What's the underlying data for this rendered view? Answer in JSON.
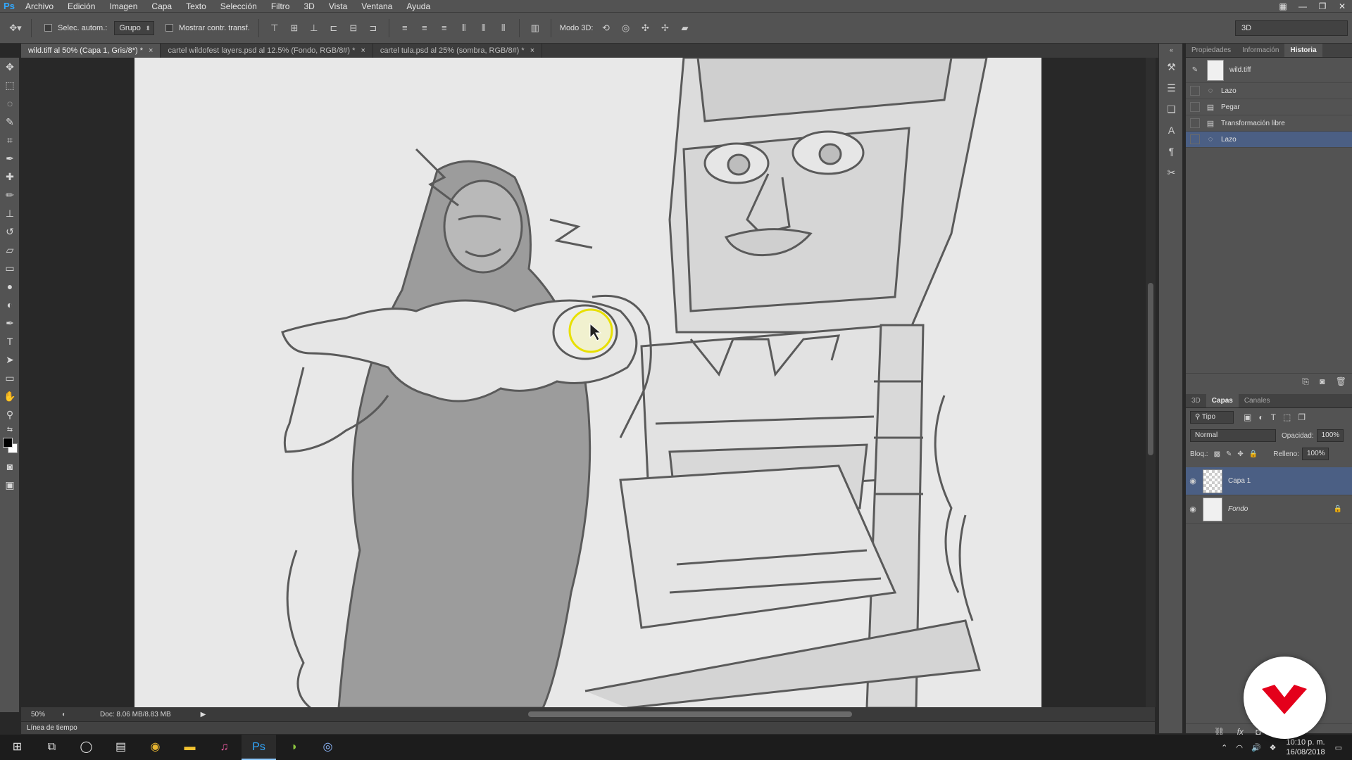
{
  "app": {
    "logo": "Ps"
  },
  "menu": [
    "Archivo",
    "Edición",
    "Imagen",
    "Capa",
    "Texto",
    "Selección",
    "Filtro",
    "3D",
    "Vista",
    "Ventana",
    "Ayuda"
  ],
  "options": {
    "auto_select_label": "Selec. autom.:",
    "auto_select_value": "Grupo",
    "transform_label": "Mostrar contr. transf.",
    "mode3d_label": "Modo 3D:",
    "workspace": "3D"
  },
  "tabs": [
    {
      "label": "wild.tiff al 50% (Capa 1, Gris/8*) *",
      "close": "×"
    },
    {
      "label": "cartel wildofest layers.psd al 12.5% (Fondo, RGB/8#) *",
      "close": "×"
    },
    {
      "label": "cartel tula.psd al 25% (sombra, RGB/8#) *",
      "close": "×"
    }
  ],
  "status": {
    "zoom": "50%",
    "doc": "Doc: 8.06 MB/8.83 MB"
  },
  "timeline": {
    "label": "Línea de tiempo"
  },
  "history_panel": {
    "tabs": [
      "Propiedades",
      "Información",
      "Historia"
    ],
    "snapshot": "wild.tiff",
    "items": [
      {
        "label": "Lazo"
      },
      {
        "label": "Pegar"
      },
      {
        "label": "Transformación libre"
      },
      {
        "label": "Lazo"
      }
    ]
  },
  "layers_panel": {
    "tabs": [
      "3D",
      "Capas",
      "Canales"
    ],
    "filter": "Tipo",
    "blend_mode": "Normal",
    "opacity_label": "Opacidad:",
    "opacity_value": "100%",
    "lock_label": "Bloq.:",
    "fill_label": "Relleno:",
    "fill_value": "100%",
    "layers": [
      {
        "name": "Capa 1"
      },
      {
        "name": "Fondo"
      }
    ]
  },
  "taskbar": {
    "time": "10:10 p. m.",
    "date": "16/08/2018"
  },
  "colors": {
    "accent": "#31a8ff",
    "selection": "#4b5f84",
    "badge": "#e4001b"
  }
}
